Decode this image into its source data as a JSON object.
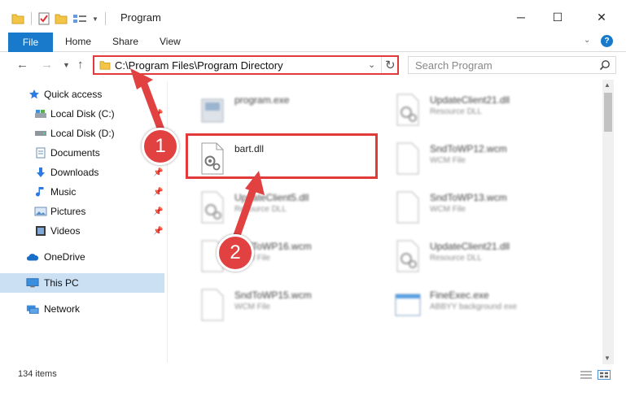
{
  "window": {
    "title": "Program",
    "minimize_glyph": "─",
    "maximize_glyph": "☐",
    "close_glyph": "✕"
  },
  "ribbon": {
    "tabs": [
      {
        "label": "File"
      },
      {
        "label": "Home"
      },
      {
        "label": "Share"
      },
      {
        "label": "View"
      }
    ],
    "help_glyph": "?"
  },
  "address": {
    "path": "C:\\Program Files\\Program Directory"
  },
  "search": {
    "placeholder": "Search Program"
  },
  "sidebar": {
    "items": [
      {
        "label": "Quick access",
        "icon": "star-icon"
      },
      {
        "label": "Local Disk (C:)",
        "icon": "drive-icon",
        "pinned": true
      },
      {
        "label": "Local Disk (D:)",
        "icon": "drive-icon",
        "pinned": true
      },
      {
        "label": "Documents",
        "icon": "documents-icon",
        "pinned": true
      },
      {
        "label": "Downloads",
        "icon": "download-icon",
        "pinned": true
      },
      {
        "label": "Music",
        "icon": "music-icon",
        "pinned": true
      },
      {
        "label": "Pictures",
        "icon": "pictures-icon",
        "pinned": true
      },
      {
        "label": "Videos",
        "icon": "videos-icon",
        "pinned": true
      },
      {
        "label": "OneDrive",
        "icon": "cloud-icon"
      },
      {
        "label": "This PC",
        "icon": "computer-icon",
        "selected": true
      },
      {
        "label": "Network",
        "icon": "network-icon"
      }
    ]
  },
  "files": [
    {
      "name": "program.exe",
      "type": ""
    },
    {
      "name": "UpdateClient21.dll",
      "type": "Resource DLL"
    },
    {
      "name": "bart.dll",
      "type": ""
    },
    {
      "name": "SndToWP12.wcm",
      "type": "WCM File"
    },
    {
      "name": "UpdateClient5.dll",
      "type": "Resource DLL"
    },
    {
      "name": "SndToWP13.wcm",
      "type": "WCM File"
    },
    {
      "name": "SndToWP16.wcm",
      "type": "WCM File"
    },
    {
      "name": "UpdateClient21.dll",
      "type": "Resource DLL"
    },
    {
      "name": "SndToWP15.wcm",
      "type": "WCM File"
    },
    {
      "name": "FineExec.exe",
      "type": "ABBYY background exe"
    }
  ],
  "status": {
    "item_count": "134 items"
  },
  "annotations": {
    "step1": "1",
    "step2": "2"
  },
  "colors": {
    "accent": "#1979ca",
    "highlight": "#e03a3a",
    "badge": "#e24141",
    "selected": "#cce0f4"
  }
}
